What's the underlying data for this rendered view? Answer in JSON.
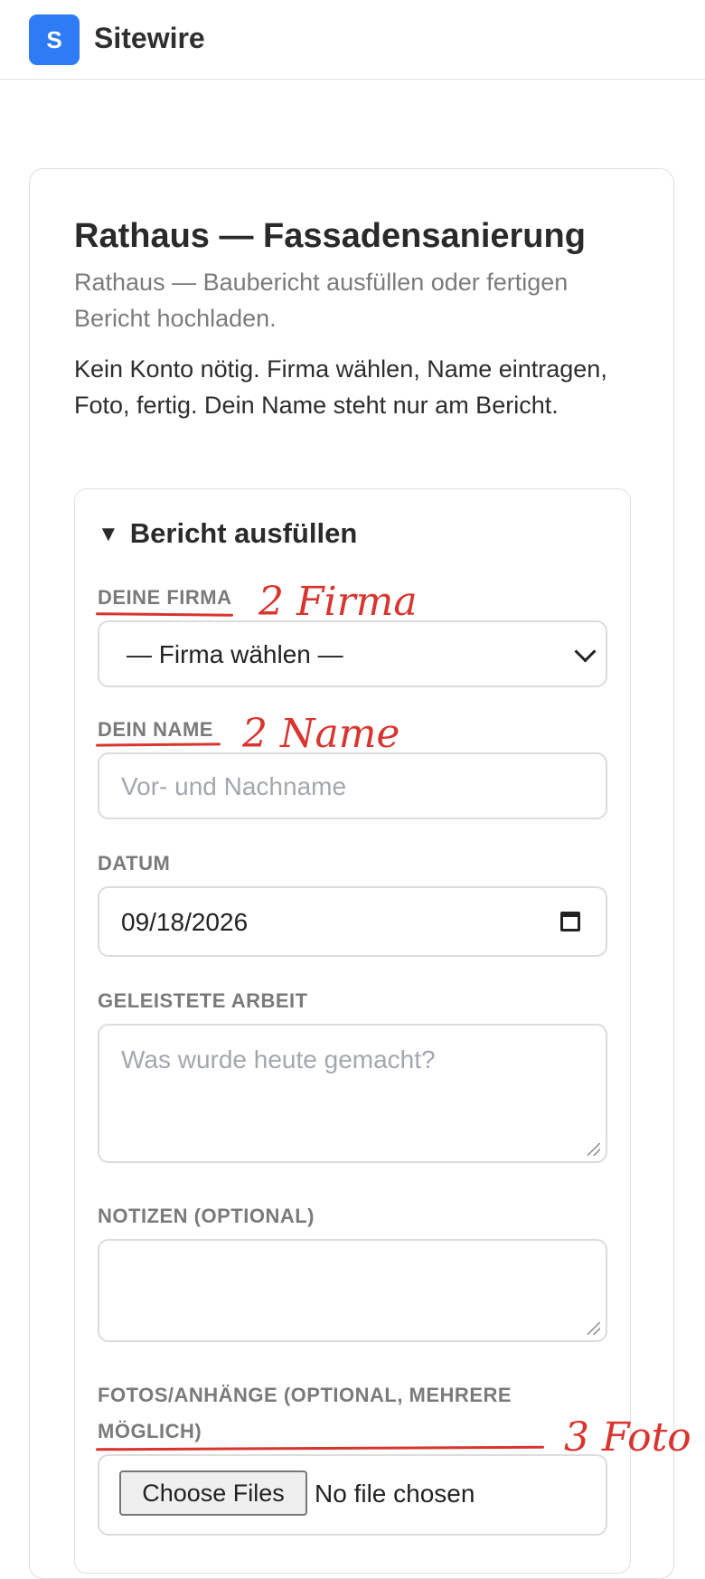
{
  "app": {
    "logo_letter": "S",
    "brand": "Sitewire"
  },
  "page": {
    "title": "Rathaus — Fassadensanierung",
    "subtitle": "Rathaus — Baubericht ausfüllen oder fertigen Bericht hochladen.",
    "intro": "Kein Konto nötig. Firma wählen, Name eintragen, Foto, fertig. Dein Name steht nur am Bericht."
  },
  "form": {
    "summary_label": "Bericht ausfüllen",
    "company": {
      "label": "DEINE FIRMA",
      "selected": "— Firma wählen —"
    },
    "name": {
      "label": "DEIN NAME",
      "placeholder": "Vor- und Nachname"
    },
    "date": {
      "label": "DATUM",
      "value": "09/18/2026"
    },
    "work": {
      "label": "GELEISTETE ARBEIT",
      "placeholder": "Was wurde heute gemacht?"
    },
    "notes": {
      "label": "NOTIZEN (OPTIONAL)",
      "value": ""
    },
    "attachments": {
      "label_line1": "FOTOS/ANHÄNGE (OPTIONAL, MEHRERE",
      "label_line2": "MÖGLICH)",
      "button": "Choose Files",
      "status": "No file chosen"
    }
  },
  "annotations": {
    "firma": "2 Firma",
    "name": "2 Name",
    "foto": "3 Foto",
    "color": "#d8352f"
  },
  "colors": {
    "accent": "#2f7bf5"
  }
}
